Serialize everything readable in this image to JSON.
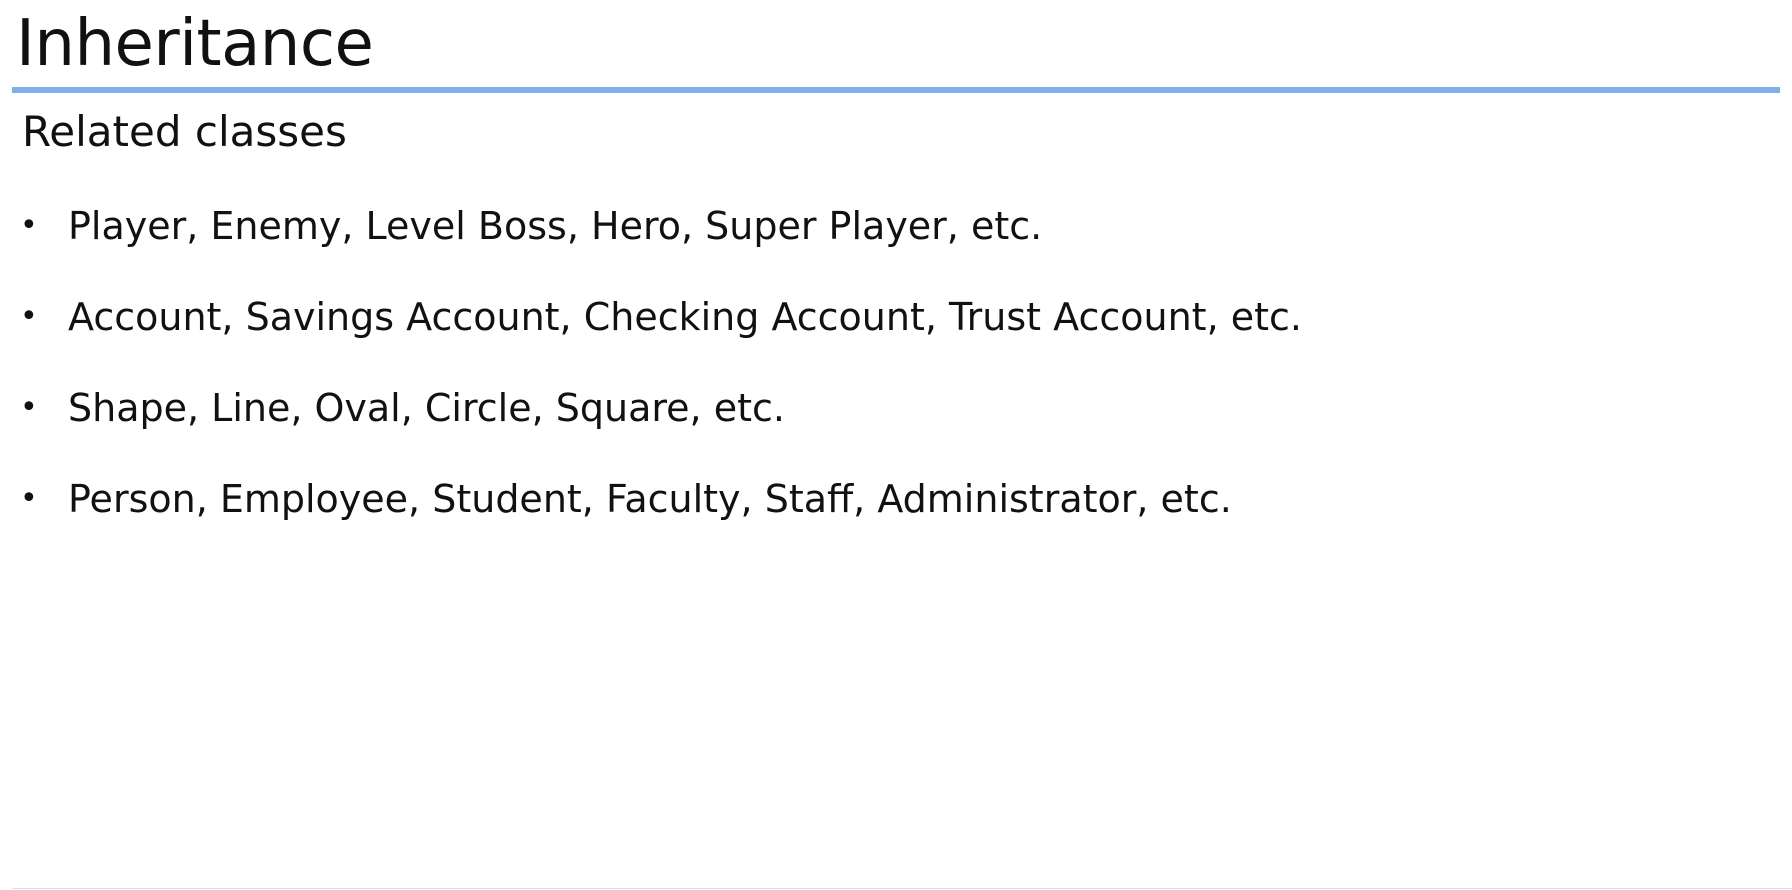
{
  "slide": {
    "title": "Inheritance",
    "subtitle": "Related classes",
    "accent_color": "#7fb0e8",
    "bullet_glyph": "•",
    "bullets": [
      "Player, Enemy, Level Boss, Hero, Super Player, etc.",
      "Account, Savings Account, Checking Account, Trust Account, etc.",
      "Shape, Line, Oval, Circle, Square, etc.",
      "Person, Employee, Student, Faculty, Staff, Administrator, etc."
    ]
  }
}
